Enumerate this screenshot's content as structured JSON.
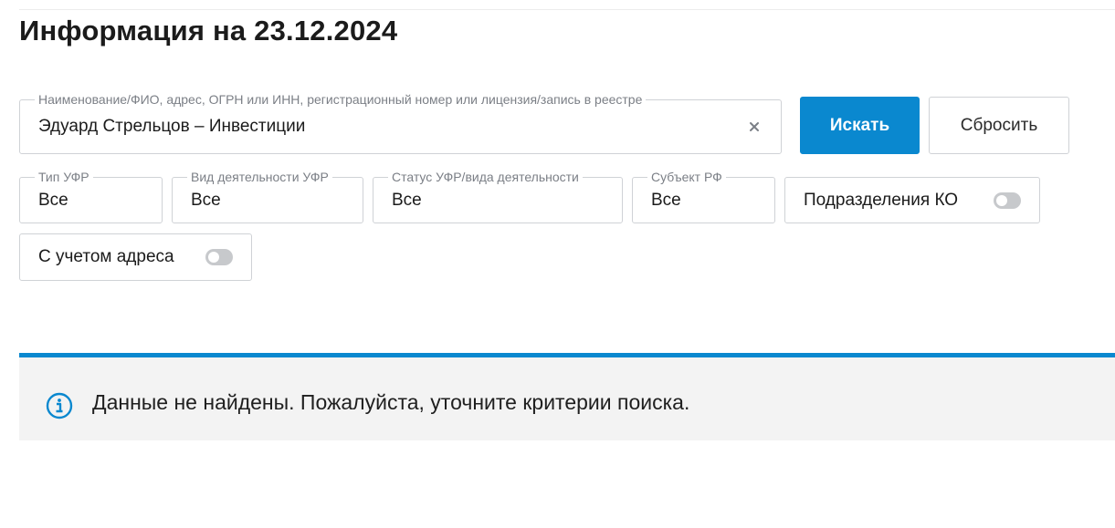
{
  "page": {
    "title": "Информация на 23.12.2024"
  },
  "search": {
    "label": "Наименование/ФИО, адрес, ОГРН или ИНН, регистрационный номер или лицензия/запись в реестре",
    "value": "Эдуард Стрельцов – Инвестиции",
    "clear_icon": "close-icon"
  },
  "buttons": {
    "search_label": "Искать",
    "reset_label": "Сбросить"
  },
  "filters": {
    "type": {
      "label": "Тип УФР",
      "value": "Все"
    },
    "activity": {
      "label": "Вид деятельности УФР",
      "value": "Все"
    },
    "status": {
      "label": "Статус УФР/вида деятельности",
      "value": "Все"
    },
    "region": {
      "label": "Субъект РФ",
      "value": "Все"
    }
  },
  "toggles": {
    "subdivisions": {
      "label": "Подразделения КО",
      "on": false
    },
    "address": {
      "label": "С учетом адреса",
      "on": false
    }
  },
  "notice": {
    "icon": "info-icon",
    "text": "Данные не найдены. Пожалуйста, уточните критерии поиска.",
    "accent_color": "#0a88cf"
  },
  "colors": {
    "primary": "#0a88cf",
    "border": "#cfd2d6",
    "notice_bg": "#f3f3f3"
  }
}
